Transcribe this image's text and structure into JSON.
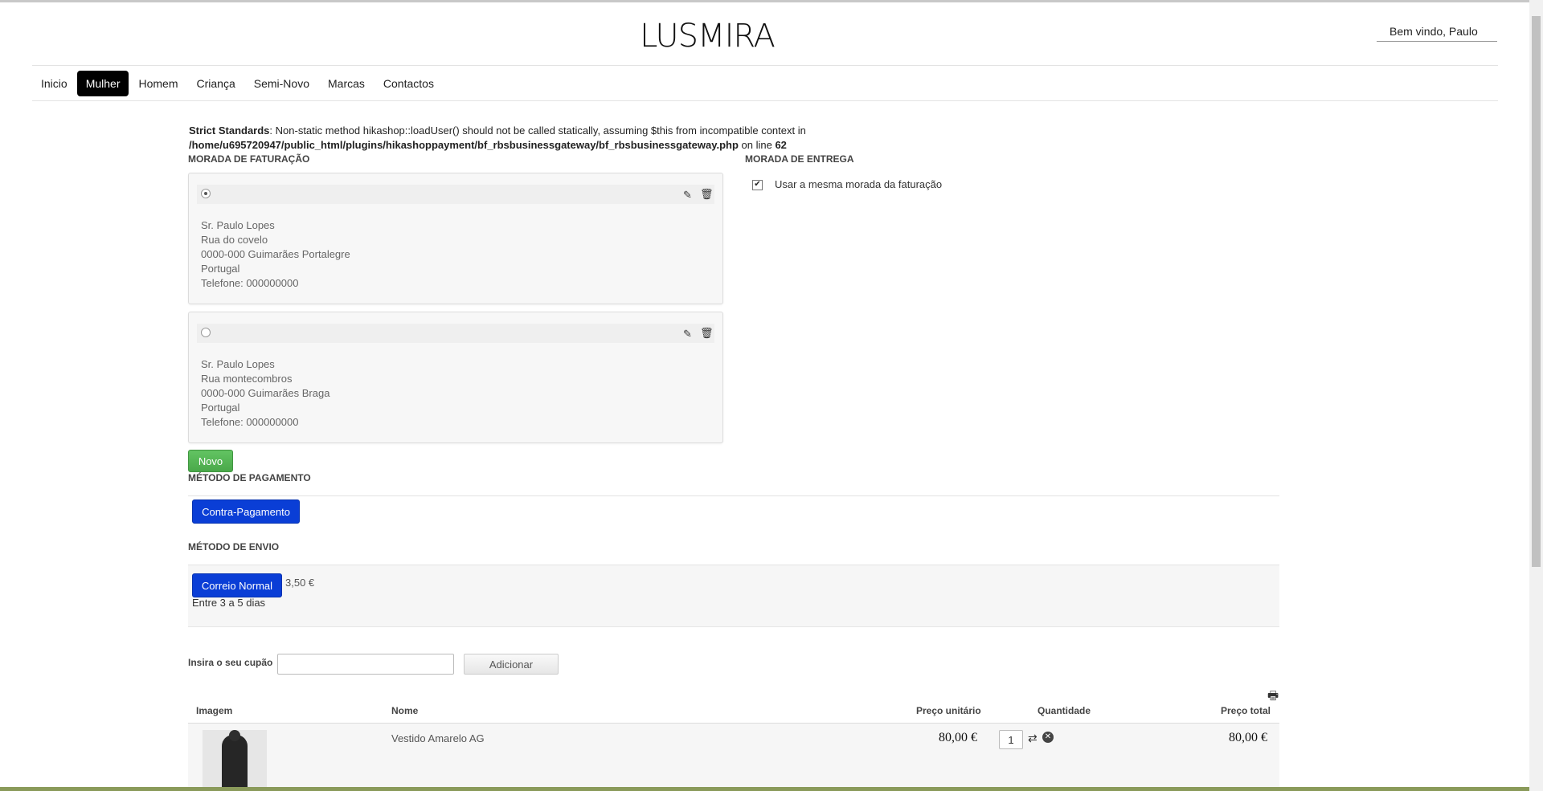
{
  "header": {
    "logo": "LUSMIRA",
    "welcome": "Bem vindo, Paulo"
  },
  "nav": [
    {
      "label": "Inicio",
      "active": false
    },
    {
      "label": "Mulher",
      "active": true
    },
    {
      "label": "Homem",
      "active": false
    },
    {
      "label": "Criança",
      "active": false
    },
    {
      "label": "Semi-Novo",
      "active": false
    },
    {
      "label": "Marcas",
      "active": false
    },
    {
      "label": "Contactos",
      "active": false
    }
  ],
  "warning": {
    "label": "Strict Standards",
    "text": ": Non-static method hikashop::loadUser() should not be called statically, assuming $this from incompatible context in",
    "path": "/home/u695720947/public_html/plugins/hikashoppayment/bf_rbsbusinessgateway/bf_rbsbusinessgateway.php",
    "online": " on line ",
    "line": "62"
  },
  "billing": {
    "title": "MORADA DE FATURAÇÃO",
    "addresses": [
      {
        "lines": [
          "Sr. Paulo Lopes",
          "Rua do covelo",
          "0000-000 Guimarães Portalegre",
          "Portugal",
          "Telefone: 000000000"
        ],
        "selected": true
      },
      {
        "lines": [
          "Sr. Paulo Lopes",
          "Rua montecombros",
          "0000-000 Guimarães Braga",
          "Portugal",
          "Telefone: 000000000"
        ],
        "selected": false
      }
    ],
    "new_button": "Novo"
  },
  "delivery": {
    "title": "MORADA DE ENTREGA",
    "same_label": "Usar a mesma morada da faturação",
    "same_checked": true
  },
  "payment": {
    "title": "MÉTODO DE PAGAMENTO",
    "option": "Contra-Pagamento"
  },
  "shipping": {
    "title": "MÉTODO DE ENVIO",
    "option": "Correio Normal",
    "price": "3,50 €",
    "description": "Entre 3 a 5 dias"
  },
  "coupon": {
    "label": "Insira o seu cupão",
    "value": "",
    "button": "Adicionar"
  },
  "cart": {
    "headers": {
      "image": "Imagem",
      "name": "Nome",
      "unit_price": "Preço unitário",
      "quantity": "Quantidade",
      "total": "Preço total"
    },
    "items": [
      {
        "name": "Vestido Amarelo AG",
        "unit_price": "80,00 €",
        "quantity": "1",
        "total": "80,00 €"
      }
    ]
  },
  "colors": {
    "accent_blue": "#0a3ed6",
    "button_green": "#5cb85c",
    "nav_active": "#000000"
  }
}
